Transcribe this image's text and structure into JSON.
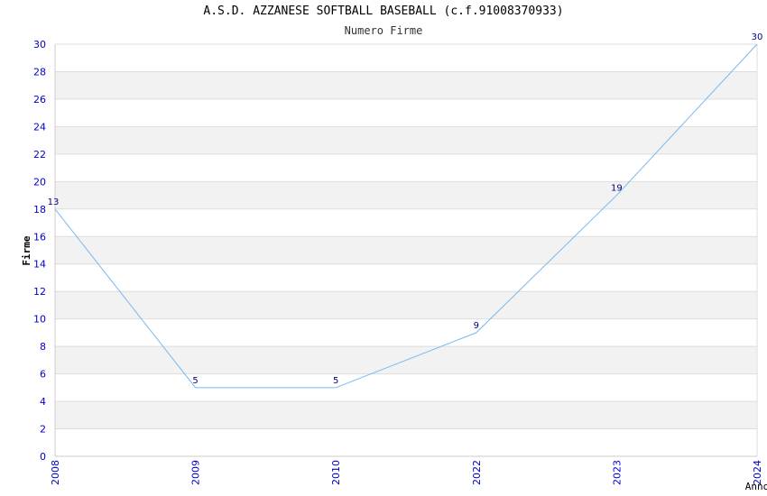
{
  "chart_data": {
    "type": "line",
    "title": "A.S.D. AZZANESE SOFTBALL BASEBALL (c.f.91008370933)",
    "subtitle": "Numero Firme",
    "xlabel": "Anno",
    "ylabel": "Firme",
    "categories": [
      "2008",
      "2009",
      "2010",
      "2022",
      "2023",
      "2024"
    ],
    "series": [
      {
        "values": [
          18,
          5,
          5,
          9,
          19,
          30
        ],
        "labels": [
          "13",
          "5",
          "5",
          "9",
          "19",
          "30"
        ]
      }
    ],
    "ylim": [
      0,
      30
    ],
    "yticks": [
      0,
      2,
      4,
      6,
      8,
      10,
      12,
      14,
      16,
      18,
      20,
      22,
      24,
      26,
      28,
      30
    ],
    "grid": true,
    "colors": {
      "line": "#7ab8f0",
      "tick_text": "#0000cc",
      "data_label": "#000080",
      "band": "#f2f2f2",
      "gridline": "#dddddd"
    }
  }
}
